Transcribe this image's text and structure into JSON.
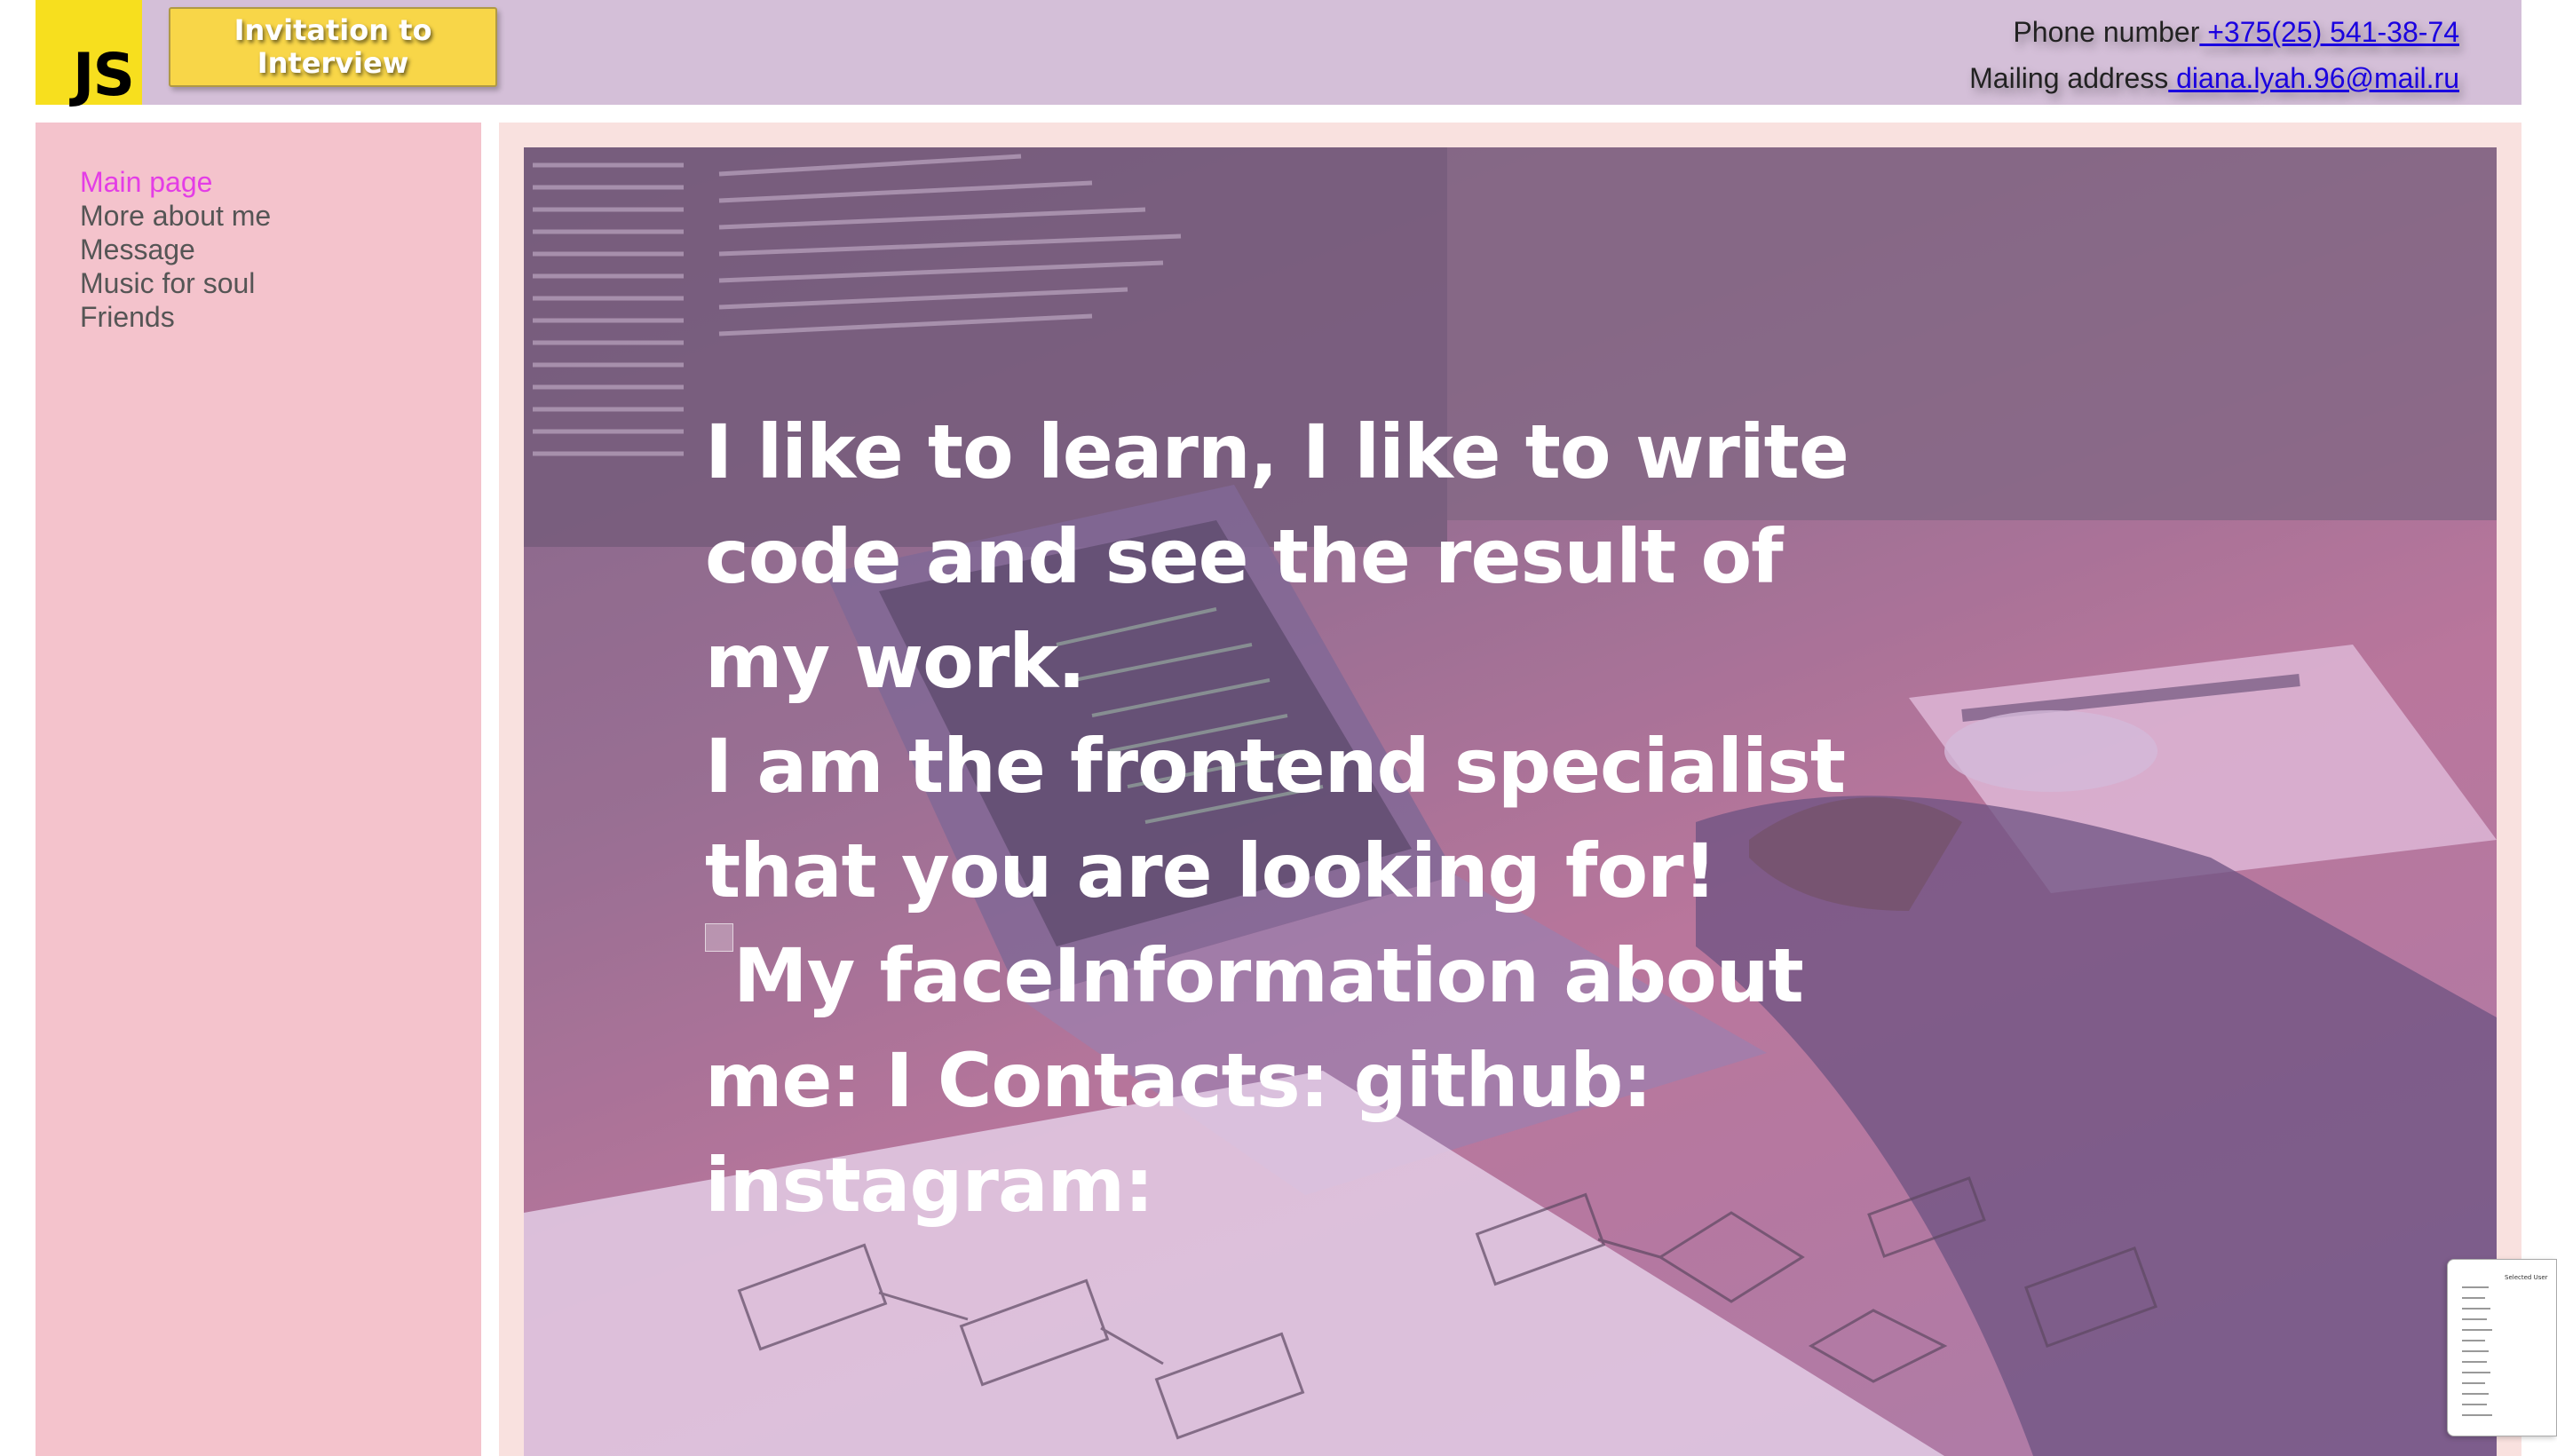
{
  "header": {
    "logo_text": "JS",
    "invite_button": "Invitation to Interview",
    "phone_label": "Phone number",
    "phone_value": " +375(25) 541-38-74",
    "mail_label": "Mailing address",
    "mail_value": " diana.lyah.96@mail.ru"
  },
  "nav": {
    "items": [
      "Main page",
      "More about me",
      "Message",
      "Music for soul",
      "Friends"
    ]
  },
  "hero": {
    "line1": "I like to learn, I like to write code and see the result of my work.",
    "line2": "I am the frontend specialist that you are looking for!",
    "img_alt": "My face",
    "line3": "Information about me: I Contacts: github: instagram:"
  },
  "mini_thumb": {
    "title": "Selected User"
  },
  "colors": {
    "header": "#d4bfd8",
    "sidebar": "#f4c3cc",
    "main": "#f9e1df",
    "active_nav": "#e43de6",
    "button": "#f8d648"
  }
}
